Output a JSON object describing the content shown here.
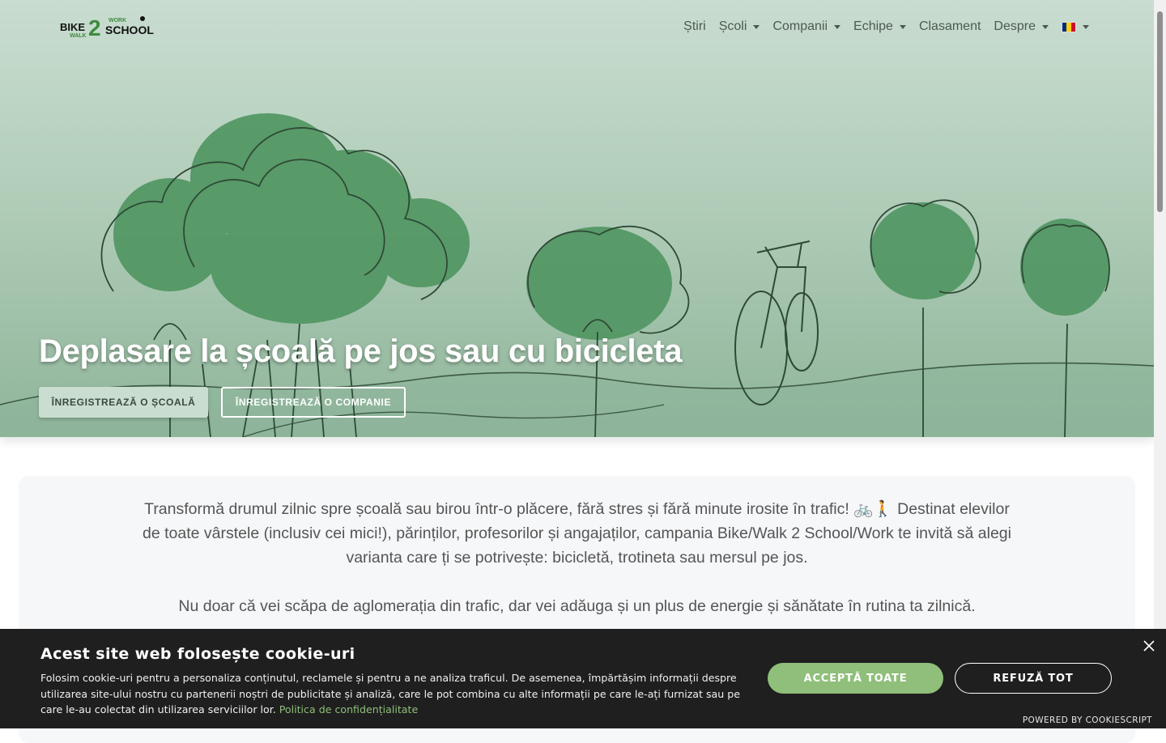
{
  "logo": {
    "words": [
      "BIKE",
      "2",
      "WALK",
      "WORK",
      "SCHOOL"
    ]
  },
  "nav": {
    "items": [
      {
        "label": "Știri",
        "dropdown": false
      },
      {
        "label": "Școli",
        "dropdown": true
      },
      {
        "label": "Companii",
        "dropdown": true
      },
      {
        "label": "Echipe",
        "dropdown": true
      },
      {
        "label": "Clasament",
        "dropdown": false
      },
      {
        "label": "Despre",
        "dropdown": true
      }
    ],
    "language_flag": "romania-flag-icon"
  },
  "hero": {
    "title": "Deplasare la școală pe jos sau cu bicicleta",
    "register_school": "Înregistrează o școală",
    "register_company": "Înregistrează o companie"
  },
  "intro": {
    "paragraph1": "Transformă drumul zilnic spre școală sau birou într-o plăcere, fără stres și fără minute irosite în trafic! 🚲🚶 Destinat elevilor de toate vârstele (inclusiv cei mici!), părinților, profesorilor și angajaților, campania Bike/Walk 2 School/Work te invită să alegi varianta care ți se potrivește: bicicletă, trotineta sau mersul pe jos.",
    "paragraph2": "Nu doar că vei scăpa de aglomerația din trafic, dar vei adăuga și un plus de energie și sănătate în rutina ta zilnică."
  },
  "cookie": {
    "title": "Acest site web folosește cookie-uri",
    "text": "Folosim cookie-uri pentru a personaliza conținutul, reclamele și pentru a ne analiza traficul. De asemenea, împărtășim informații despre utilizarea site-ului nostru cu partenerii noștri de publicitate și analiză, care le pot combina cu alte informații pe care le-ați furnizat sau pe care le-au colectat din utilizarea serviciilor lor.",
    "policy_link": "Politica de confidențialitate",
    "accept": "ACCEPTĂ TOATE",
    "reject": "REFUZĂ TOT",
    "powered": "POWERED BY COOKIESCRIPT"
  },
  "colors": {
    "accent_green": "#8fbf7a",
    "tree_green": "#5f9a6c",
    "banner_bg": "#1f1f1f"
  }
}
